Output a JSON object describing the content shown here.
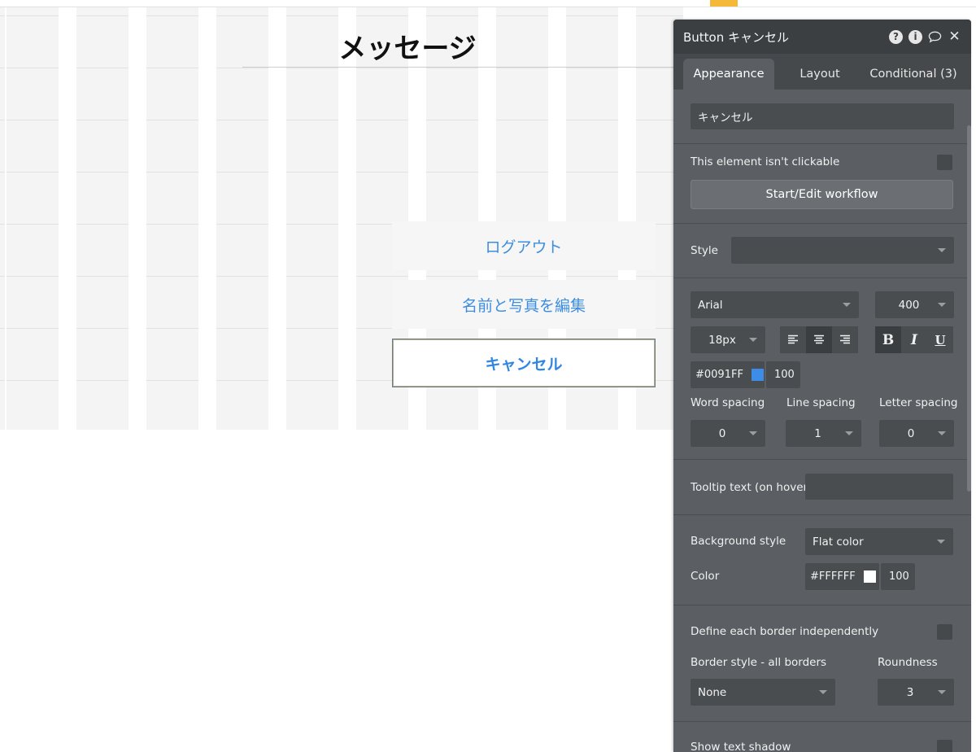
{
  "canvas": {
    "title": "メッセージ",
    "menu_buttons": [
      "ログアウト",
      "名前と写真を編集"
    ],
    "cancel_button": "キャンセル"
  },
  "panel": {
    "title": "Button キャンセル",
    "header_icons": [
      "help-icon",
      "info-icon",
      "comment-icon",
      "close-icon"
    ],
    "tabs": [
      "Appearance",
      "Layout",
      "Conditional (3)"
    ],
    "active_tab": "Appearance",
    "text_value": "キャンセル",
    "not_clickable_label": "This element isn't clickable",
    "workflow_button": "Start/Edit workflow",
    "style_label": "Style",
    "style_value": "",
    "font_family": "Arial",
    "font_weight": "400",
    "font_size": "18px",
    "text_align": [
      "align-left-icon",
      "align-center-icon",
      "align-right-icon"
    ],
    "text_align_selected": "center",
    "format_buttons": [
      "B",
      "I",
      "U"
    ],
    "font_color": "#0091FF",
    "font_opacity": "100",
    "word_spacing_label": "Word spacing",
    "word_spacing": "0",
    "line_spacing_label": "Line spacing",
    "line_spacing": "1",
    "letter_spacing_label": "Letter spacing",
    "letter_spacing": "0",
    "tooltip_label": "Tooltip text (on hover)",
    "tooltip_value": "",
    "background_style_label": "Background style",
    "background_style": "Flat color",
    "color_label": "Color",
    "bg_color": "#FFFFFF",
    "bg_opacity": "100",
    "border_independent_label": "Define each border independently",
    "border_style_label": "Border style - all borders",
    "border_style": "None",
    "roundness_label": "Roundness",
    "roundness": "3",
    "text_shadow_label": "Show text shadow"
  },
  "colors": {
    "accent_marker": "#F5B939",
    "font_color_swatch": "#3d8de8",
    "bg_color_swatch": "#FFFFFF"
  }
}
